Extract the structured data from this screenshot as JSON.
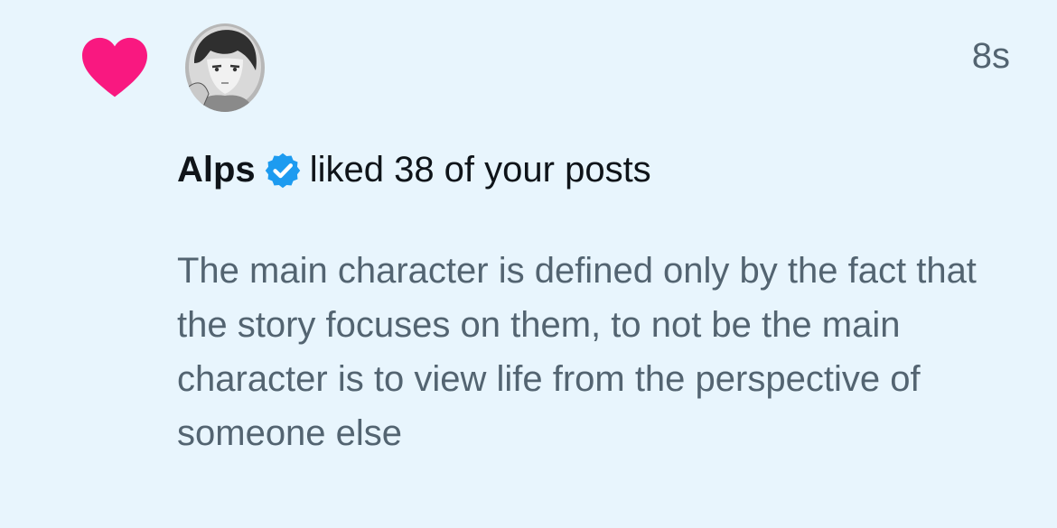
{
  "notification": {
    "type_icon": "heart-icon",
    "avatar_icon": "avatar",
    "timestamp": "8s",
    "user": {
      "name": "Alps",
      "verified_icon": "verified-badge-icon"
    },
    "action_text": "liked 38 of your posts",
    "post_text": "The main character is defined only by the fact that the story focuses on them, to not be the main character is to view life from the perspective of someone else"
  },
  "colors": {
    "background": "#e8f5fd",
    "heart": "#f91880",
    "verified": "#1d9bf0",
    "primary_text": "#0f1419",
    "secondary_text": "#536471"
  }
}
